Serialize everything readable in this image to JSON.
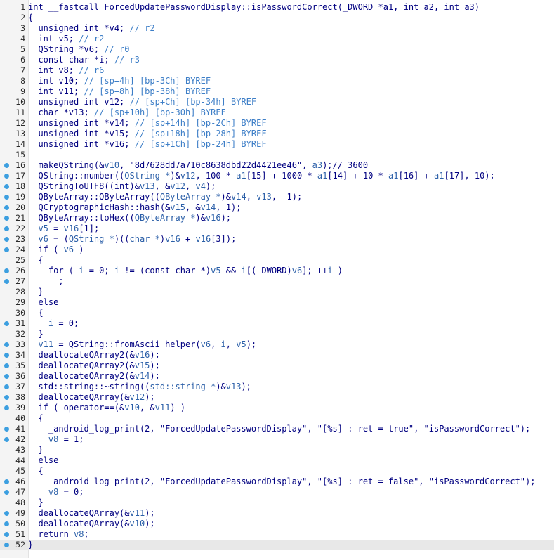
{
  "colors": {
    "code": "#000080",
    "variable": "#2b5fa8",
    "comment": "#3d7ec7",
    "breakpoint": "#3c9fe0",
    "gutter_bg": "#f4f4f4",
    "current_line_bg": "#e8e8e8"
  },
  "current_line": 52,
  "lines": [
    {
      "n": "1",
      "bp": false,
      "tokens": [
        [
          "k",
          "int __fastcall ForcedUpdatePasswordDisplay::isPasswordCorrect(_DWORD *a1, int a2, int a3)"
        ]
      ]
    },
    {
      "n": "2",
      "bp": false,
      "tokens": [
        [
          "k",
          "{"
        ]
      ]
    },
    {
      "n": "3",
      "bp": false,
      "tokens": [
        [
          "k",
          "  unsigned int *v4; "
        ],
        [
          "c",
          "// r2"
        ]
      ]
    },
    {
      "n": "4",
      "bp": false,
      "tokens": [
        [
          "k",
          "  int v5; "
        ],
        [
          "c",
          "// r2"
        ]
      ]
    },
    {
      "n": "5",
      "bp": false,
      "tokens": [
        [
          "k",
          "  QString *v6; "
        ],
        [
          "c",
          "// r0"
        ]
      ]
    },
    {
      "n": "6",
      "bp": false,
      "tokens": [
        [
          "k",
          "  const char *i; "
        ],
        [
          "c",
          "// r3"
        ]
      ]
    },
    {
      "n": "7",
      "bp": false,
      "tokens": [
        [
          "k",
          "  int v8; "
        ],
        [
          "c",
          "// r6"
        ]
      ]
    },
    {
      "n": "8",
      "bp": false,
      "tokens": [
        [
          "k",
          "  int v10; "
        ],
        [
          "c",
          "// [sp+4h] [bp-3Ch] BYREF"
        ]
      ]
    },
    {
      "n": "9",
      "bp": false,
      "tokens": [
        [
          "k",
          "  int v11; "
        ],
        [
          "c",
          "// [sp+8h] [bp-38h] BYREF"
        ]
      ]
    },
    {
      "n": "10",
      "bp": false,
      "tokens": [
        [
          "k",
          "  unsigned int v12; "
        ],
        [
          "c",
          "// [sp+Ch] [bp-34h] BYREF"
        ]
      ]
    },
    {
      "n": "11",
      "bp": false,
      "tokens": [
        [
          "k",
          "  char *v13; "
        ],
        [
          "c",
          "// [sp+10h] [bp-30h] BYREF"
        ]
      ]
    },
    {
      "n": "12",
      "bp": false,
      "tokens": [
        [
          "k",
          "  unsigned int *v14; "
        ],
        [
          "c",
          "// [sp+14h] [bp-2Ch] BYREF"
        ]
      ]
    },
    {
      "n": "13",
      "bp": false,
      "tokens": [
        [
          "k",
          "  unsigned int *v15; "
        ],
        [
          "c",
          "// [sp+18h] [bp-28h] BYREF"
        ]
      ]
    },
    {
      "n": "14",
      "bp": false,
      "tokens": [
        [
          "k",
          "  unsigned int *v16; "
        ],
        [
          "c",
          "// [sp+1Ch] [bp-24h] BYREF"
        ]
      ]
    },
    {
      "n": "15",
      "bp": false,
      "tokens": [
        [
          "k",
          ""
        ]
      ]
    },
    {
      "n": "16",
      "bp": true,
      "tokens": [
        [
          "k",
          "  makeQString(&"
        ],
        [
          "v",
          "v10"
        ],
        [
          "k",
          ", \"8d7628dd7a710c8638dbd22d4421ee46\", "
        ],
        [
          "v",
          "a3"
        ],
        [
          "k",
          ");// 3600"
        ]
      ]
    },
    {
      "n": "17",
      "bp": true,
      "tokens": [
        [
          "k",
          "  QString::number(("
        ],
        [
          "v",
          "QString *"
        ],
        [
          "k",
          ")&"
        ],
        [
          "v",
          "v12"
        ],
        [
          "k",
          ", 100 * "
        ],
        [
          "v",
          "a1"
        ],
        [
          "k",
          "[15] + 1000 * "
        ],
        [
          "v",
          "a1"
        ],
        [
          "k",
          "[14] + 10 * "
        ],
        [
          "v",
          "a1"
        ],
        [
          "k",
          "[16] + "
        ],
        [
          "v",
          "a1"
        ],
        [
          "k",
          "[17], 10);"
        ]
      ]
    },
    {
      "n": "18",
      "bp": true,
      "tokens": [
        [
          "k",
          "  QStringToUTF8((int)&"
        ],
        [
          "v",
          "v13"
        ],
        [
          "k",
          ", &"
        ],
        [
          "v",
          "v12"
        ],
        [
          "k",
          ", "
        ],
        [
          "v",
          "v4"
        ],
        [
          "k",
          ");"
        ]
      ]
    },
    {
      "n": "19",
      "bp": true,
      "tokens": [
        [
          "k",
          "  QByteArray::QByteArray(("
        ],
        [
          "v",
          "QByteArray *"
        ],
        [
          "k",
          ")&"
        ],
        [
          "v",
          "v14"
        ],
        [
          "k",
          ", "
        ],
        [
          "v",
          "v13"
        ],
        [
          "k",
          ", -1);"
        ]
      ]
    },
    {
      "n": "20",
      "bp": true,
      "tokens": [
        [
          "k",
          "  QCryptographicHash::hash(&"
        ],
        [
          "v",
          "v15"
        ],
        [
          "k",
          ", &"
        ],
        [
          "v",
          "v14"
        ],
        [
          "k",
          ", 1);"
        ]
      ]
    },
    {
      "n": "21",
      "bp": true,
      "tokens": [
        [
          "k",
          "  QByteArray::toHex(("
        ],
        [
          "v",
          "QByteArray *"
        ],
        [
          "k",
          ")&"
        ],
        [
          "v",
          "v16"
        ],
        [
          "k",
          ");"
        ]
      ]
    },
    {
      "n": "22",
      "bp": true,
      "tokens": [
        [
          "v",
          "  v5"
        ],
        [
          "k",
          " = "
        ],
        [
          "v",
          "v16"
        ],
        [
          "k",
          "[1];"
        ]
      ]
    },
    {
      "n": "23",
      "bp": true,
      "tokens": [
        [
          "v",
          "  v6"
        ],
        [
          "k",
          " = ("
        ],
        [
          "v",
          "QString *"
        ],
        [
          "k",
          ")(("
        ],
        [
          "v",
          "char *"
        ],
        [
          "k",
          ")"
        ],
        [
          "v",
          "v16"
        ],
        [
          "k",
          " + "
        ],
        [
          "v",
          "v16"
        ],
        [
          "k",
          "[3]);"
        ]
      ]
    },
    {
      "n": "24",
      "bp": true,
      "tokens": [
        [
          "k",
          "  if ( "
        ],
        [
          "v",
          "v6"
        ],
        [
          "k",
          " )"
        ]
      ]
    },
    {
      "n": "25",
      "bp": false,
      "tokens": [
        [
          "k",
          "  {"
        ]
      ]
    },
    {
      "n": "26",
      "bp": true,
      "tokens": [
        [
          "k",
          "    for ( "
        ],
        [
          "v",
          "i"
        ],
        [
          "k",
          " = 0; "
        ],
        [
          "v",
          "i"
        ],
        [
          "k",
          " != (const char *)"
        ],
        [
          "v",
          "v5"
        ],
        [
          "k",
          " && "
        ],
        [
          "v",
          "i"
        ],
        [
          "k",
          "[(_DWORD)"
        ],
        [
          "v",
          "v6"
        ],
        [
          "k",
          "]; ++"
        ],
        [
          "v",
          "i"
        ],
        [
          "k",
          " )"
        ]
      ]
    },
    {
      "n": "27",
      "bp": true,
      "tokens": [
        [
          "k",
          "      ;"
        ]
      ]
    },
    {
      "n": "28",
      "bp": false,
      "tokens": [
        [
          "k",
          "  }"
        ]
      ]
    },
    {
      "n": "29",
      "bp": false,
      "tokens": [
        [
          "k",
          "  else"
        ]
      ]
    },
    {
      "n": "30",
      "bp": false,
      "tokens": [
        [
          "k",
          "  {"
        ]
      ]
    },
    {
      "n": "31",
      "bp": true,
      "tokens": [
        [
          "v",
          "    i"
        ],
        [
          "k",
          " = 0;"
        ]
      ]
    },
    {
      "n": "32",
      "bp": false,
      "tokens": [
        [
          "k",
          "  }"
        ]
      ]
    },
    {
      "n": "33",
      "bp": true,
      "tokens": [
        [
          "v",
          "  v11"
        ],
        [
          "k",
          " = QString::fromAscii_helper("
        ],
        [
          "v",
          "v6"
        ],
        [
          "k",
          ", "
        ],
        [
          "v",
          "i"
        ],
        [
          "k",
          ", "
        ],
        [
          "v",
          "v5"
        ],
        [
          "k",
          ");"
        ]
      ]
    },
    {
      "n": "34",
      "bp": true,
      "tokens": [
        [
          "k",
          "  deallocateQArray2(&"
        ],
        [
          "v",
          "v16"
        ],
        [
          "k",
          ");"
        ]
      ]
    },
    {
      "n": "35",
      "bp": true,
      "tokens": [
        [
          "k",
          "  deallocateQArray2(&"
        ],
        [
          "v",
          "v15"
        ],
        [
          "k",
          ");"
        ]
      ]
    },
    {
      "n": "36",
      "bp": true,
      "tokens": [
        [
          "k",
          "  deallocateQArray2(&"
        ],
        [
          "v",
          "v14"
        ],
        [
          "k",
          ");"
        ]
      ]
    },
    {
      "n": "37",
      "bp": true,
      "tokens": [
        [
          "k",
          "  std::string::~string(("
        ],
        [
          "v",
          "std::string *"
        ],
        [
          "k",
          ")&"
        ],
        [
          "v",
          "v13"
        ],
        [
          "k",
          ");"
        ]
      ]
    },
    {
      "n": "38",
      "bp": true,
      "tokens": [
        [
          "k",
          "  deallocateQArray(&"
        ],
        [
          "v",
          "v12"
        ],
        [
          "k",
          ");"
        ]
      ]
    },
    {
      "n": "39",
      "bp": true,
      "tokens": [
        [
          "k",
          "  if ( operator==(&"
        ],
        [
          "v",
          "v10"
        ],
        [
          "k",
          ", &"
        ],
        [
          "v",
          "v11"
        ],
        [
          "k",
          ") )"
        ]
      ]
    },
    {
      "n": "40",
      "bp": false,
      "tokens": [
        [
          "k",
          "  {"
        ]
      ]
    },
    {
      "n": "41",
      "bp": true,
      "tokens": [
        [
          "k",
          "    _android_log_print(2, \"ForcedUpdatePasswordDisplay\", \"[%s] : ret = true\", \"isPasswordCorrect\");"
        ]
      ]
    },
    {
      "n": "42",
      "bp": true,
      "tokens": [
        [
          "v",
          "    v8"
        ],
        [
          "k",
          " = 1;"
        ]
      ]
    },
    {
      "n": "43",
      "bp": false,
      "tokens": [
        [
          "k",
          "  }"
        ]
      ]
    },
    {
      "n": "44",
      "bp": false,
      "tokens": [
        [
          "k",
          "  else"
        ]
      ]
    },
    {
      "n": "45",
      "bp": false,
      "tokens": [
        [
          "k",
          "  {"
        ]
      ]
    },
    {
      "n": "46",
      "bp": true,
      "tokens": [
        [
          "k",
          "    _android_log_print(2, \"ForcedUpdatePasswordDisplay\", \"[%s] : ret = false\", \"isPasswordCorrect\");"
        ]
      ]
    },
    {
      "n": "47",
      "bp": true,
      "tokens": [
        [
          "v",
          "    v8"
        ],
        [
          "k",
          " = 0;"
        ]
      ]
    },
    {
      "n": "48",
      "bp": false,
      "tokens": [
        [
          "k",
          "  }"
        ]
      ]
    },
    {
      "n": "49",
      "bp": true,
      "tokens": [
        [
          "k",
          "  deallocateQArray(&"
        ],
        [
          "v",
          "v11"
        ],
        [
          "k",
          ");"
        ]
      ]
    },
    {
      "n": "50",
      "bp": true,
      "tokens": [
        [
          "k",
          "  deallocateQArray(&"
        ],
        [
          "v",
          "v10"
        ],
        [
          "k",
          ");"
        ]
      ]
    },
    {
      "n": "51",
      "bp": true,
      "tokens": [
        [
          "k",
          "  return "
        ],
        [
          "v",
          "v8"
        ],
        [
          "k",
          ";"
        ]
      ]
    },
    {
      "n": "52",
      "bp": true,
      "tokens": [
        [
          "k",
          "}"
        ]
      ]
    }
  ]
}
